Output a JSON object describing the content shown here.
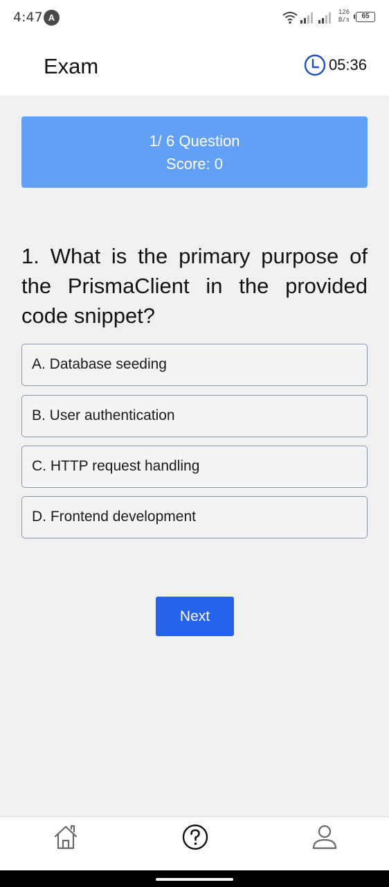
{
  "status_bar": {
    "time": "4:47",
    "app_icon": "A",
    "net_speed_value": "126",
    "net_speed_unit": "B/s",
    "battery": "65"
  },
  "header": {
    "title": "Exam",
    "timer": "05:36"
  },
  "score_card": {
    "progress": "1/ 6 Question",
    "score": "Score: 0"
  },
  "question": {
    "text": "1. What is the primary purpose of the PrismaClient in the provided code snippet?"
  },
  "options": [
    {
      "label": "A. Database seeding"
    },
    {
      "label": "B. User authentication"
    },
    {
      "label": "C. HTTP request handling"
    },
    {
      "label": "D. Frontend development"
    }
  ],
  "next_button": {
    "label": "Next"
  },
  "bottom_nav": {
    "items": [
      {
        "icon": "home-icon"
      },
      {
        "icon": "question-icon"
      },
      {
        "icon": "user-icon"
      }
    ]
  },
  "colors": {
    "score_card": "#62a0f8",
    "next_button": "#2563eb",
    "clock_icon": "#1f4fb8"
  }
}
